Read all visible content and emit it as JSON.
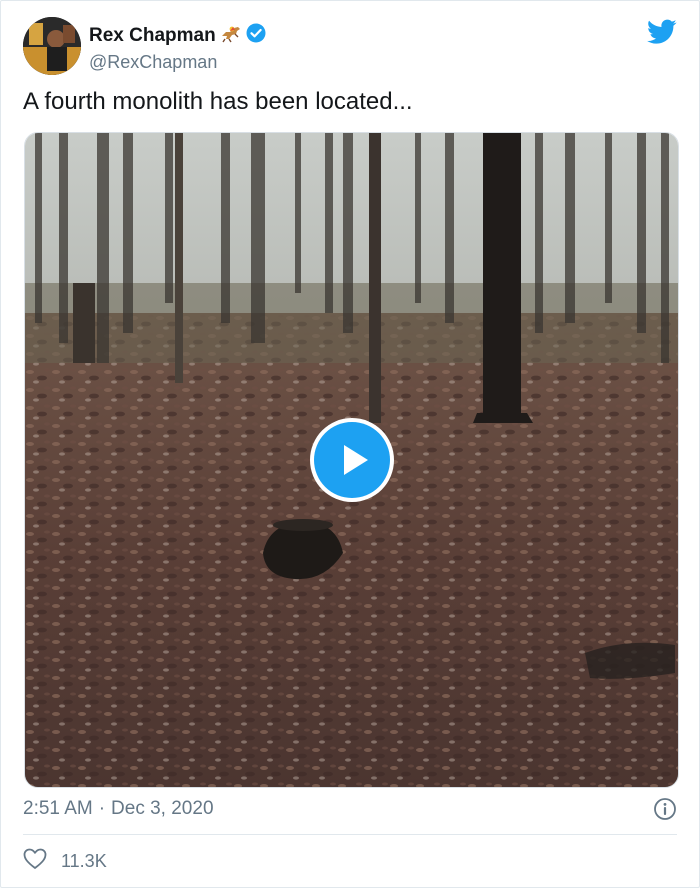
{
  "user": {
    "display_name": "Rex Chapman",
    "handle": "@RexChapman",
    "verified": true,
    "name_emoji": "horse-racing-icon"
  },
  "tweet": {
    "text": "A fourth monolith has been located...",
    "media": {
      "type": "video",
      "scene": "forest floor covered in fallen leaves"
    }
  },
  "meta": {
    "time": "2:51 AM",
    "separator": "·",
    "date": "Dec 3, 2020"
  },
  "actions": {
    "likes": "11.3K"
  },
  "colors": {
    "brand_blue": "#1da1f2",
    "text": "#14171a",
    "muted": "#657786"
  }
}
